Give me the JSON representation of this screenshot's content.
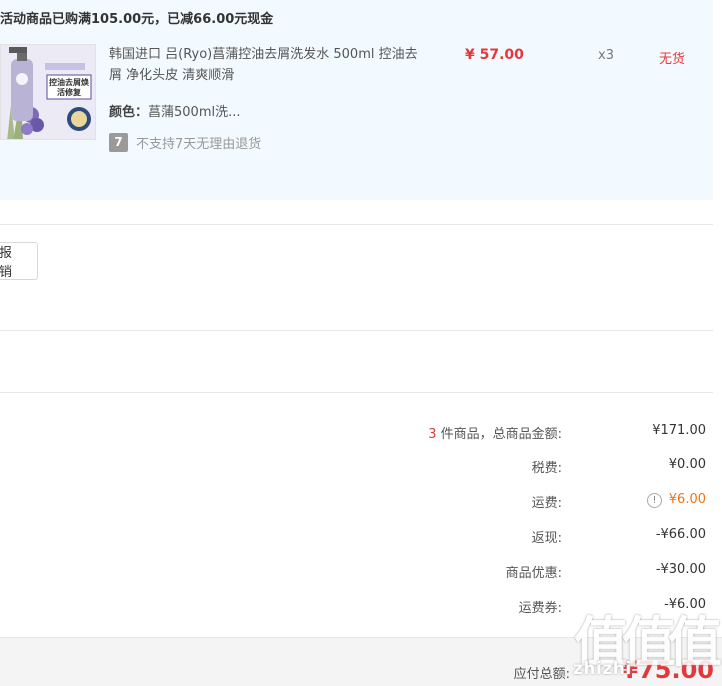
{
  "promo": {
    "title": "活动商品已购满105.00元，已减66.00元现金",
    "product": {
      "image_icon": "shampoo-bottle-image",
      "image_text": "控油去屑焕活修复",
      "name": "韩国进口 吕(Ryo)菖蒲控油去屑洗发水 500ml 控油去屑 净化头皮 清爽顺滑",
      "price": "¥ 57.00",
      "quantity": "x3",
      "stock_status": "无货",
      "color_label": "颜色：",
      "color_value": "菖蒲500ml洗...",
      "no_return_icon": "7",
      "no_return_text": "不支持7天无理由退货"
    }
  },
  "reimburse_button": "报销",
  "summary": {
    "item_count": "3",
    "items_label": " 件商品，总商品金额:",
    "items_value": "¥171.00",
    "tax_label": "税费:",
    "tax_value": "¥0.00",
    "shipping_label": "运费:",
    "shipping_value": "¥6.00",
    "rebate_label": "返现:",
    "rebate_value": "-¥66.00",
    "discount_label": "商品优惠:",
    "discount_value": "-¥30.00",
    "coupon_label": "运费券:",
    "coupon_value": "-¥6.00",
    "total_label": "应付总额:",
    "total_value": "¥75.00"
  },
  "watermark": {
    "mark": "值",
    "text": "zhizhi"
  },
  "colors": {
    "accent_red": "#e4393c",
    "shipping_orange": "#f07316",
    "promo_bg": "#f3faff"
  }
}
